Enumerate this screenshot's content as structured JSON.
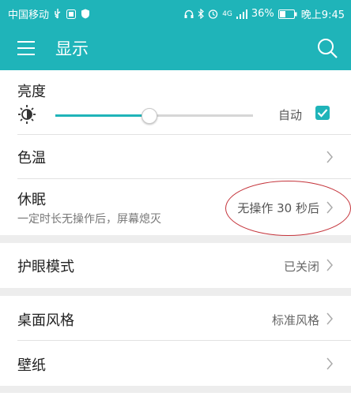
{
  "status_bar": {
    "carrier": "中国移动",
    "battery": "36%",
    "time": "晚上9:45",
    "network": "4G"
  },
  "header": {
    "title": "显示"
  },
  "brightness": {
    "label": "亮度",
    "auto_label": "自动",
    "auto_checked": true,
    "level": 0.47
  },
  "settings": {
    "color_temp": {
      "label": "色温"
    },
    "sleep": {
      "label": "休眠",
      "subtitle": "一定时长无操作后，屏幕熄灭",
      "value": "无操作 30 秒后"
    },
    "eye_mode": {
      "label": "护眼模式",
      "value": "已关闭"
    },
    "desktop_style": {
      "label": "桌面风格",
      "value": "标准风格"
    },
    "wallpaper": {
      "label": "壁纸"
    }
  },
  "colors": {
    "accent": "#1fb4b9",
    "annotation": "#c4333a"
  }
}
